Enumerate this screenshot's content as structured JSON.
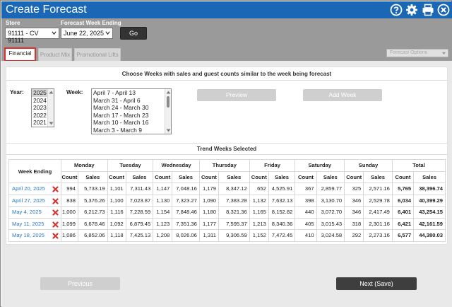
{
  "header": {
    "title": "Create Forecast",
    "color": "#1a67b6",
    "icons": [
      "help-icon",
      "gear-icon",
      "print-icon",
      "close-icon"
    ]
  },
  "filters": {
    "store_label": "Store",
    "store_value": "91111 - CV 91111",
    "week_label": "Forecast Week Ending",
    "week_value": "June 22, 2025",
    "go_label": "Go"
  },
  "tabs": [
    {
      "label": "Financial",
      "active": true
    },
    {
      "label": "Product Mix",
      "active": false
    },
    {
      "label": "Promotional Lifts",
      "active": false
    }
  ],
  "forecast_options": "Forecast Options",
  "choose": {
    "title": "Choose Weeks with sales and guest counts similar to the week being forecast",
    "year_label": "Year:",
    "years": [
      "2025",
      "2024",
      "2023",
      "2022",
      "2021"
    ],
    "selected_year": "2025",
    "week_label": "Week:",
    "weeks": [
      "April 7 - April 13",
      "March 31 - April 6",
      "March 24 - March 30",
      "March 17 - March 23",
      "March 10 - March 16",
      "March 3 - March 9"
    ],
    "preview_label": "Preview",
    "add_week_label": "Add Week"
  },
  "trend": {
    "title": "Trend Weeks Selected",
    "week_ending_header": "Week Ending",
    "days": [
      "Monday",
      "Tuesday",
      "Wednesday",
      "Thursday",
      "Friday",
      "Saturday",
      "Sunday",
      "Total"
    ],
    "count_label": "Count",
    "sales_label": "Sales",
    "rows": [
      {
        "week": "April 20, 2025",
        "values": [
          "994",
          "5,733.19",
          "1,101",
          "7,311.43",
          "1,147",
          "7,048.16",
          "1,179",
          "8,347.12",
          "652",
          "4,525.91",
          "367",
          "2,859.77",
          "325",
          "2,571.16",
          "5,765",
          "38,396.74"
        ]
      },
      {
        "week": "April 27, 2025",
        "values": [
          "838",
          "5,376.26",
          "1,100",
          "7,023.87",
          "1,130",
          "7,323.27",
          "1,090",
          "7,383.28",
          "1,132",
          "7,632.13",
          "398",
          "3,130.70",
          "346",
          "2,529.78",
          "6,034",
          "40,399.29"
        ]
      },
      {
        "week": "May 4, 2025",
        "values": [
          "1,000",
          "6,212.73",
          "1,116",
          "7,228.59",
          "1,154",
          "7,848.46",
          "1,180",
          "8,321.36",
          "1,165",
          "8,152.82",
          "440",
          "3,072.70",
          "346",
          "2,417.49",
          "6,401",
          "43,254.15"
        ]
      },
      {
        "week": "May 11, 2025",
        "values": [
          "1,099",
          "6,678.46",
          "1,092",
          "6,879.45",
          "1,123",
          "7,351.36",
          "1,177",
          "7,595.37",
          "1,213",
          "8,340.36",
          "405",
          "3,015.43",
          "318",
          "2,301.16",
          "6,421",
          "42,161.59"
        ]
      },
      {
        "week": "May 18, 2025",
        "values": [
          "1,086",
          "6,852.06",
          "1,118",
          "7,425.13",
          "1,208",
          "8,026.06",
          "1,311",
          "9,306.59",
          "1,152",
          "7,472.45",
          "410",
          "3,024.58",
          "292",
          "2,273.16",
          "6,577",
          "44,380.03"
        ]
      }
    ]
  },
  "footer": {
    "previous_label": "Previous",
    "next_label": "Next (Save)"
  }
}
